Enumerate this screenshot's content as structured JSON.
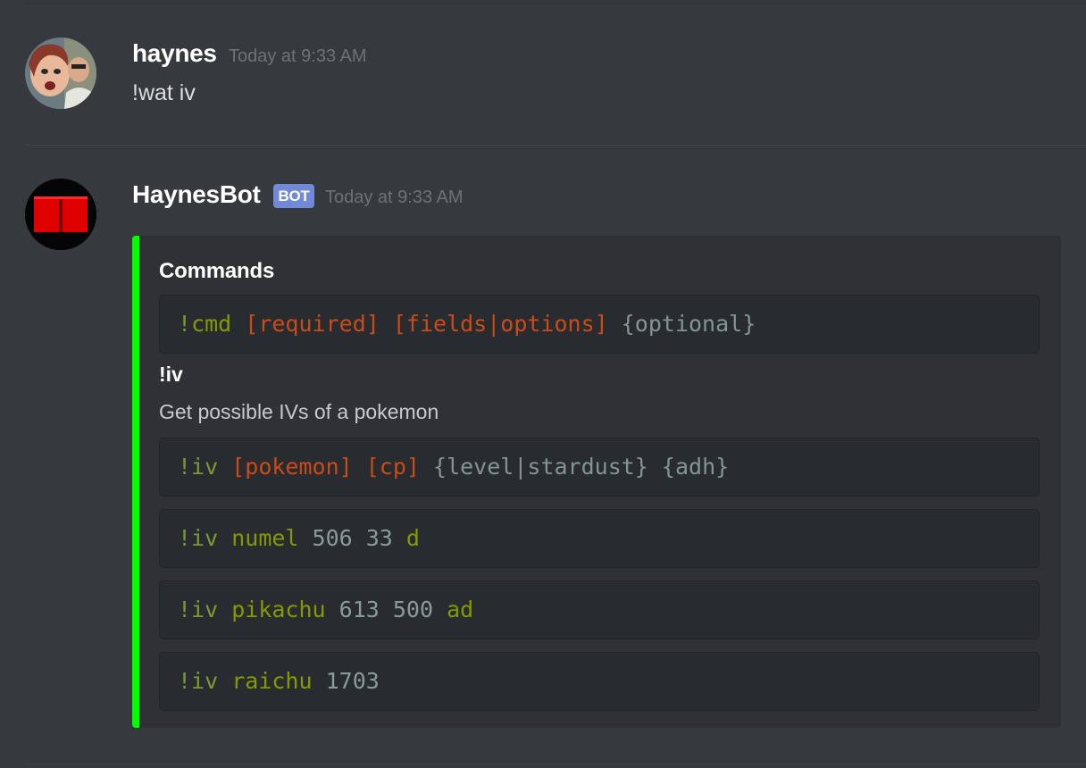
{
  "messages": [
    {
      "author": "haynes",
      "timestamp": "Today at 9:33 AM",
      "text": "!wat iv"
    },
    {
      "author": "HaynesBot",
      "badge": "BOT",
      "timestamp": "Today at 9:33 AM",
      "embed": {
        "accent_color": "#00ff00",
        "title": "Commands",
        "syntax": {
          "bang": "!",
          "cmd": "cmd",
          "required": "[required]",
          "fields": "[fields|options]",
          "optional": "{optional}"
        },
        "field_name": "!iv",
        "field_description": "Get possible IVs of a pokemon",
        "usage": {
          "cmd": "!iv",
          "required_1": "[pokemon]",
          "required_2": "[cp]",
          "optional_1": "{level|stardust}",
          "optional_2": "{adh}"
        },
        "examples": [
          {
            "cmd": "!iv",
            "pokemon": "numel",
            "nums": "506 33",
            "flags": "d"
          },
          {
            "cmd": "!iv",
            "pokemon": "pikachu",
            "nums": "613 500",
            "flags": "ad"
          },
          {
            "cmd": "!iv",
            "pokemon": "raichu",
            "nums": "1703",
            "flags": ""
          }
        ]
      }
    }
  ]
}
